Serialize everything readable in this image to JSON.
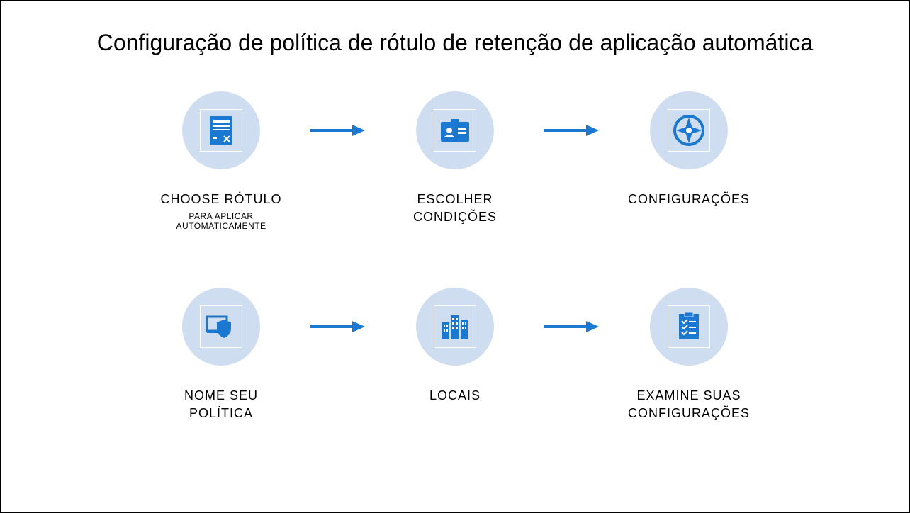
{
  "title": "Configuração de política de rótulo de retenção de aplicação automática",
  "steps": {
    "row1": [
      {
        "label": "CHOOSE  RÓTULO",
        "sub": "PARA APLICAR AUTOMATICAMENTE",
        "icon": "document"
      },
      {
        "label": "ESCOLHER CONDIÇÕES",
        "sub": "",
        "icon": "badge"
      },
      {
        "label": "CONFIGURAÇÕES",
        "sub": "",
        "icon": "compass"
      }
    ],
    "row2": [
      {
        "label": "NOME  SEU POLÍTICA",
        "sub": "",
        "icon": "shield"
      },
      {
        "label": "LOCAIS",
        "sub": "",
        "icon": "buildings"
      },
      {
        "label": "EXAMINE SUAS CONFIGURAÇÕES",
        "sub": "",
        "icon": "checklist"
      }
    ]
  }
}
